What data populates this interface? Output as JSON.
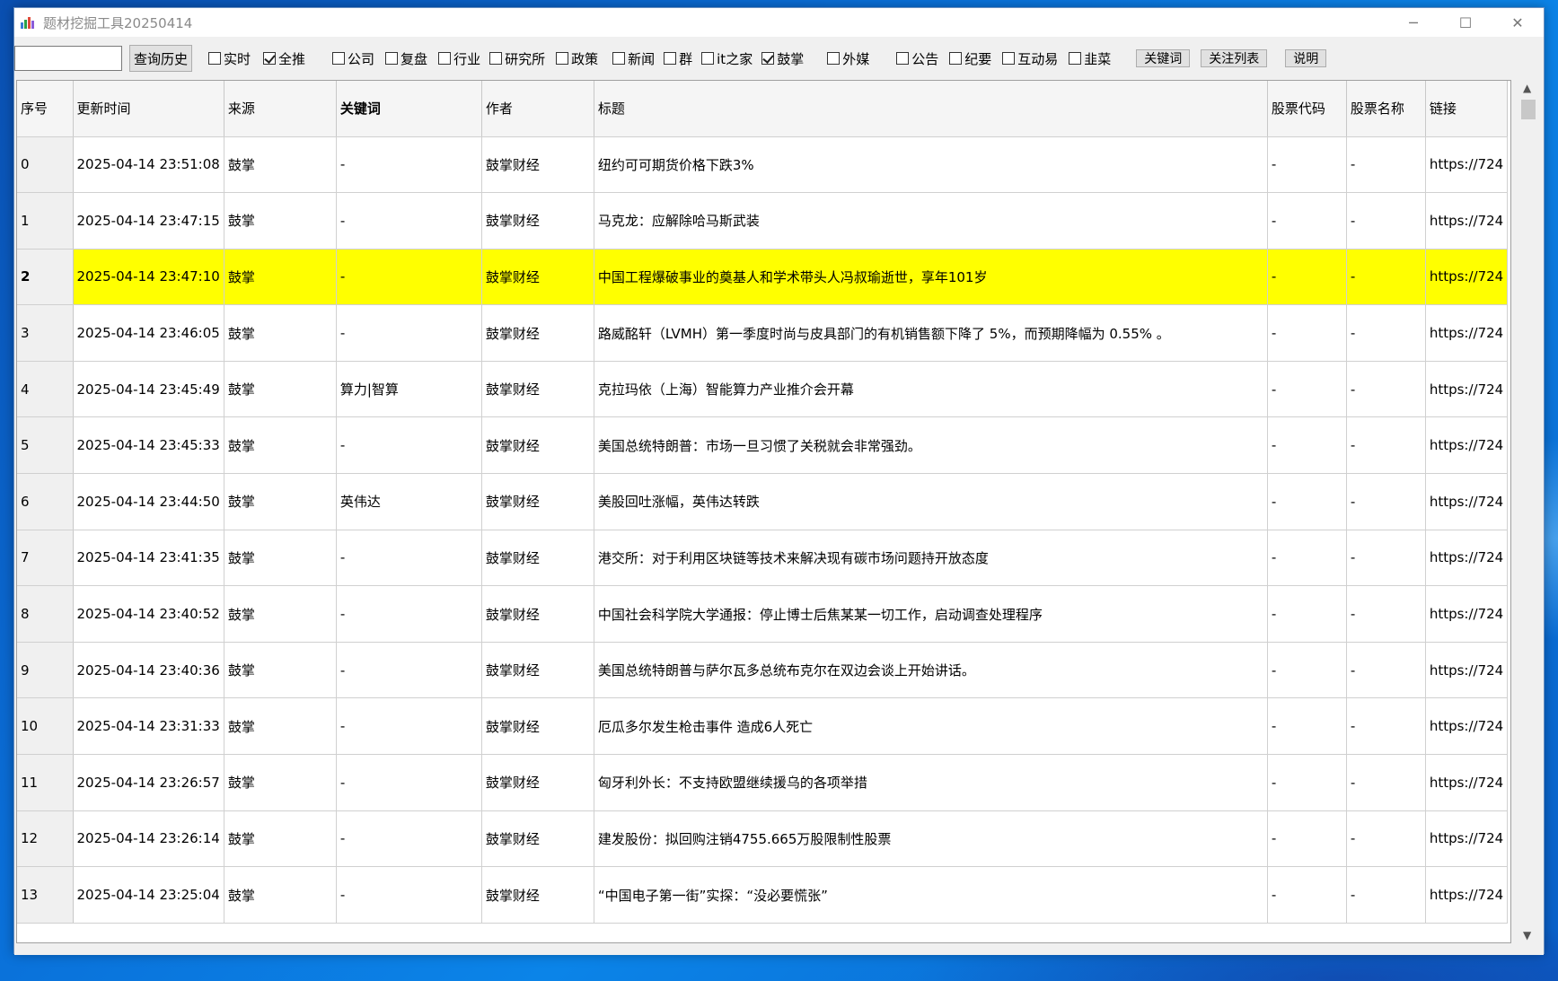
{
  "window": {
    "title": "题材挖掘工具20250414",
    "controls": {
      "minimize": "─",
      "maximize": "☐",
      "close": "✕"
    }
  },
  "toolbar": {
    "search_value": "",
    "history_button": "查询历史",
    "checkboxes": [
      {
        "label": "实时",
        "checked": false
      },
      {
        "label": "全推",
        "checked": true
      },
      {
        "label": "公司",
        "checked": false
      },
      {
        "label": "复盘",
        "checked": false
      },
      {
        "label": "行业",
        "checked": false
      },
      {
        "label": "研究所",
        "checked": false
      },
      {
        "label": "政策",
        "checked": false
      },
      {
        "label": "新闻",
        "checked": false
      },
      {
        "label": "群",
        "checked": false
      },
      {
        "label": "it之家",
        "checked": false
      },
      {
        "label": "鼓掌",
        "checked": true
      },
      {
        "label": "外媒",
        "checked": false
      },
      {
        "label": "公告",
        "checked": false
      },
      {
        "label": "纪要",
        "checked": false
      },
      {
        "label": "互动易",
        "checked": false
      },
      {
        "label": "韭菜",
        "checked": false
      }
    ],
    "keyword_button": "关键词",
    "watchlist_button": "关注列表",
    "help_button": "说明"
  },
  "table": {
    "headers": [
      "序号",
      "更新时间",
      "来源",
      "关键词",
      "作者",
      "标题",
      "股票代码",
      "股票名称",
      "链接"
    ],
    "selected_row": 2,
    "rows": [
      [
        "0",
        "2025-04-14 23:51:08",
        "鼓掌",
        "-",
        "鼓掌财经",
        "纽约可可期货价格下跌3%",
        "-",
        "-",
        "https://724"
      ],
      [
        "1",
        "2025-04-14 23:47:15",
        "鼓掌",
        "-",
        "鼓掌财经",
        "马克龙：应解除哈马斯武装",
        "-",
        "-",
        "https://724"
      ],
      [
        "2",
        "2025-04-14 23:47:10",
        "鼓掌",
        "-",
        "鼓掌财经",
        "中国工程爆破事业的奠基人和学术带头人冯叔瑜逝世，享年101岁",
        "-",
        "-",
        "https://724"
      ],
      [
        "3",
        "2025-04-14 23:46:05",
        "鼓掌",
        "-",
        "鼓掌财经",
        "路威酩轩（LVMH）第一季度时尚与皮具部门的有机销售额下降了 5%，而预期降幅为 0.55% 。",
        "-",
        "-",
        "https://724"
      ],
      [
        "4",
        "2025-04-14 23:45:49",
        "鼓掌",
        "算力|智算",
        "鼓掌财经",
        "克拉玛依（上海）智能算力产业推介会开幕",
        "-",
        "-",
        "https://724"
      ],
      [
        "5",
        "2025-04-14 23:45:33",
        "鼓掌",
        "-",
        "鼓掌财经",
        "美国总统特朗普：市场一旦习惯了关税就会非常强劲。",
        "-",
        "-",
        "https://724"
      ],
      [
        "6",
        "2025-04-14 23:44:50",
        "鼓掌",
        "英伟达",
        "鼓掌财经",
        "美股回吐涨幅，英伟达转跌",
        "-",
        "-",
        "https://724"
      ],
      [
        "7",
        "2025-04-14 23:41:35",
        "鼓掌",
        "-",
        "鼓掌财经",
        "港交所：对于利用区块链等技术来解决现有碳市场问题持开放态度",
        "-",
        "-",
        "https://724"
      ],
      [
        "8",
        "2025-04-14 23:40:52",
        "鼓掌",
        "-",
        "鼓掌财经",
        "中国社会科学院大学通报：停止博士后焦某某一切工作，启动调查处理程序",
        "-",
        "-",
        "https://724"
      ],
      [
        "9",
        "2025-04-14 23:40:36",
        "鼓掌",
        "-",
        "鼓掌财经",
        "美国总统特朗普与萨尔瓦多总统布克尔在双边会谈上开始讲话。",
        "-",
        "-",
        "https://724"
      ],
      [
        "10",
        "2025-04-14 23:31:33",
        "鼓掌",
        "-",
        "鼓掌财经",
        "厄瓜多尔发生枪击事件 造成6人死亡",
        "-",
        "-",
        "https://724"
      ],
      [
        "11",
        "2025-04-14 23:26:57",
        "鼓掌",
        "-",
        "鼓掌财经",
        "匈牙利外长：不支持欧盟继续援乌的各项举措",
        "-",
        "-",
        "https://724"
      ],
      [
        "12",
        "2025-04-14 23:26:14",
        "鼓掌",
        "-",
        "鼓掌财经",
        "建发股份：拟回购注销4755.665万股限制性股票",
        "-",
        "-",
        "https://724"
      ],
      [
        "13",
        "2025-04-14 23:25:04",
        "鼓掌",
        "-",
        "鼓掌财经",
        "“中国电子第一街”实探：“没必要慌张”",
        "-",
        "-",
        "https://724"
      ]
    ]
  },
  "colors": {
    "selected_row": "#ffff00",
    "window_bg": "#f0f0f0"
  },
  "icons": {
    "app": "app-icon",
    "scroll_up": "chevron-up-icon",
    "scroll_down": "chevron-down-icon"
  }
}
